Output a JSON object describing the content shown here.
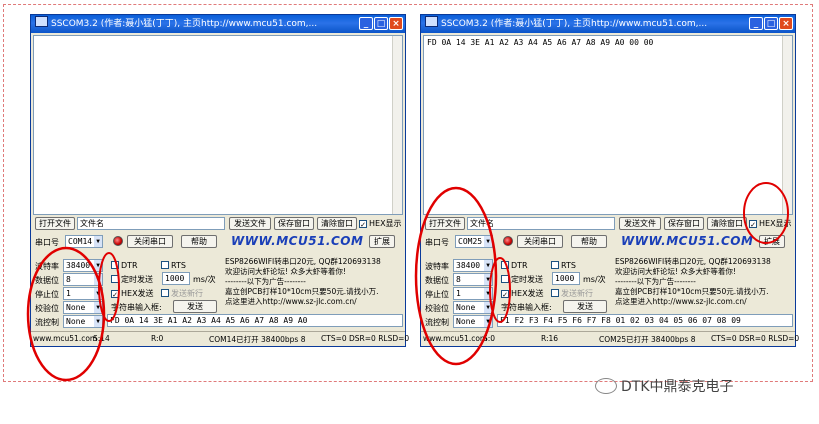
{
  "left": {
    "title": "SSCOM3.2 (作者:聂小猛(丁丁), 主页http://www.mcu51.com,...",
    "receive_text": "",
    "open_file": "打开文件",
    "filename": "文件名",
    "send_file": "发送文件",
    "save_window": "保存窗口",
    "clear_window": "清除窗口",
    "hex_display": "HEX显示",
    "hex_display_checked": true,
    "port_label": "串口号",
    "port_value": "COM14",
    "close_port": "关闭串口",
    "help": "帮助",
    "logo": "WWW.MCU51.COM",
    "expand": "扩展",
    "baud_label": "波特率",
    "baud_value": "38400",
    "databits_label": "数据位",
    "databits_value": "8",
    "stopbits_label": "停止位",
    "stopbits_value": "1",
    "parity_label": "校验位",
    "parity_value": "None",
    "flow_label": "流控制",
    "flow_value": "None",
    "dtr": "DTR",
    "rts": "RTS",
    "timed_send": "定时发送",
    "interval": "1000",
    "interval_unit": "ms/次",
    "hex_send": "HEX发送",
    "hex_send_checked": true,
    "send_newline": "发送新行",
    "input_label": "字符串输入框:",
    "send": "发送",
    "ad_line1": "ESP8266WIFI转串口20元, QQ群120693138",
    "ad_line2": "欢迎访问大虾论坛! 众多大虾等着你!",
    "ad_line3": "--------以下为广告--------",
    "ad_line4": "嘉立创PCB打样10*10cm只要50元.请找小万.",
    "ad_line5": "点这里进入http://www.sz-jlc.com.cn/",
    "send_text": "FD 0A 14 3E A1 A2 A3 A4 A5 A6 A7 A8 A9 A0",
    "status_site": "www.mcu51.com",
    "status_s": "S:14",
    "status_r": "R:0",
    "status_port": "COM14已打开  38400bps  8",
    "status_lines": "CTS=0 DSR=0 RLSD=0"
  },
  "right": {
    "title": "SSCOM3.2 (作者:聂小猛(丁丁), 主页http://www.mcu51.com,...",
    "receive_text": "FD 0A 14 3E A1 A2 A3 A4 A5 A6 A7 A8 A9 A0 00 00",
    "open_file": "打开文件",
    "filename": "文件名",
    "send_file": "发送文件",
    "save_window": "保存窗口",
    "clear_window": "清除窗口",
    "hex_display": "HEX显示",
    "hex_display_checked": true,
    "port_label": "串口号",
    "port_value": "COM25",
    "close_port": "关闭串口",
    "help": "帮助",
    "logo": "WWW.MCU51.COM",
    "expand": "扩展",
    "baud_label": "波特率",
    "baud_value": "38400",
    "databits_label": "数据位",
    "databits_value": "8",
    "stopbits_label": "停止位",
    "stopbits_value": "1",
    "parity_label": "校验位",
    "parity_value": "None",
    "flow_label": "流控制",
    "flow_value": "None",
    "dtr": "DTR",
    "rts": "RTS",
    "timed_send": "定时发送",
    "interval": "1000",
    "interval_unit": "ms/次",
    "hex_send": "HEX发送",
    "hex_send_checked": true,
    "send_newline": "发送新行",
    "input_label": "字符串输入框:",
    "send": "发送",
    "ad_line1": "ESP8266WIFI转串口20元, QQ群120693138",
    "ad_line2": "欢迎访问大虾论坛! 众多大虾等着你!",
    "ad_line3": "--------以下为广告--------",
    "ad_line4": "嘉立创PCB打样10*10cm只要50元.请找小万.",
    "ad_line5": "点这里进入http://www.sz-jlc.com.cn/",
    "send_text": "F1 F2 F3 F4 F5 F6 F7 F8 01 02 03 04 05 06 07 08 09",
    "status_site": "www.mcu51.com",
    "status_s": "S:0",
    "status_r": "R:16",
    "status_port": "COM25已打开  38400bps  8",
    "status_lines": "CTS=0 DSR=0 RLSD=0"
  },
  "watermark": "DTK中鼎泰克电子",
  "colors": {
    "annotation": "#e00000",
    "titlebar": "#0a5fd8"
  }
}
